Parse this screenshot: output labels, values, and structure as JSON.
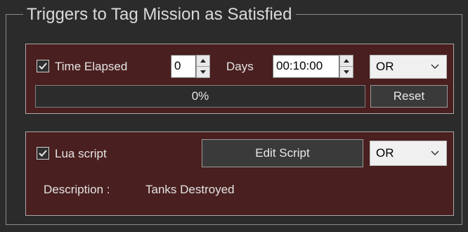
{
  "group": {
    "title": "Triggers to Tag Mission as Satisfied"
  },
  "time_trigger": {
    "checked": true,
    "label": "Time Elapsed",
    "days_value": "0",
    "days_label": "Days",
    "time_value": "00:10:00",
    "logic": "OR",
    "progress_text": "0%",
    "progress_fraction": 0,
    "reset_label": "Reset"
  },
  "lua_trigger": {
    "checked": true,
    "label": "Lua script",
    "edit_label": "Edit Script",
    "logic": "OR",
    "description_label": "Description :",
    "description_value": "Tanks Destroyed"
  },
  "colors": {
    "panel_bg": "#4a1f1f",
    "window_bg": "#2b2b2b",
    "progress_fill": "#3c8a3c"
  },
  "icons": {
    "check": "check-icon",
    "spin_up": "spin-up-icon",
    "spin_down": "spin-down-icon",
    "dropdown": "chevron-down-icon"
  }
}
